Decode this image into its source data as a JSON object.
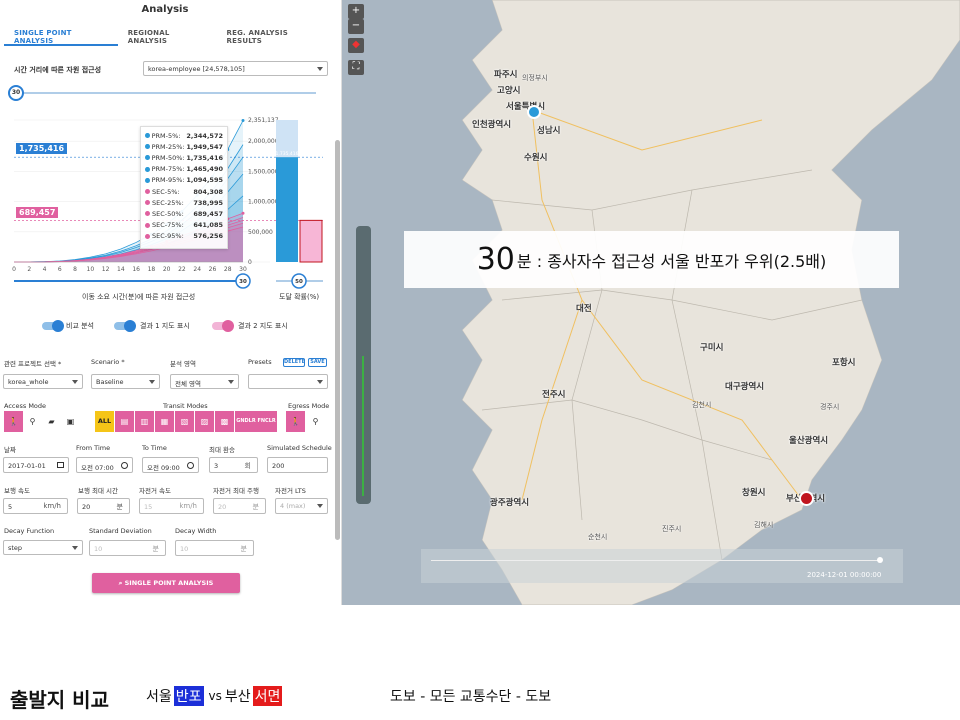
{
  "panel": {
    "title": "Analysis",
    "tabs": [
      "SINGLE POINT ANALYSIS",
      "REGIONAL ANALYSIS",
      "REG. ANALYSIS RESULTS"
    ],
    "accessibility_label": "시간 거리에 따른 자원 접근성",
    "dataset_select": "korea-employee [24,578,105]",
    "time_slider_value": "30"
  },
  "chart_data": {
    "type": "area",
    "x": [
      0,
      2,
      4,
      6,
      8,
      10,
      12,
      14,
      16,
      18,
      20,
      22,
      24,
      26,
      28,
      30
    ],
    "xlabel": "이동 소요 시간(분)에 따른 자원 접근성",
    "ylim": [
      0,
      2351137
    ],
    "yticks": [
      "2,351,137",
      "2,000,000",
      "1,500,000",
      "1,000,000",
      "500,000",
      "0"
    ],
    "primary_marker": "1,735,416",
    "secondary_marker": "689,457",
    "tooltip": [
      {
        "name": "PRM-5%:",
        "value": "2,344,572",
        "color": "#2a9ad8"
      },
      {
        "name": "PRM-25%:",
        "value": "1,949,547",
        "color": "#2a9ad8"
      },
      {
        "name": "PRM-50%:",
        "value": "1,735,416",
        "color": "#2a9ad8"
      },
      {
        "name": "PRM-75%:",
        "value": "1,465,490",
        "color": "#2a9ad8"
      },
      {
        "name": "PRM-95%:",
        "value": "1,094,595",
        "color": "#2a9ad8"
      },
      {
        "name": "SEC-5%:",
        "value": "804,308",
        "color": "#e0609f"
      },
      {
        "name": "SEC-25%:",
        "value": "738,995",
        "color": "#e0609f"
      },
      {
        "name": "SEC-50%:",
        "value": "689,457",
        "color": "#e0609f"
      },
      {
        "name": "SEC-75%:",
        "value": "641,085",
        "color": "#e0609f"
      },
      {
        "name": "SEC-95%:",
        "value": "576,256",
        "color": "#e0609f"
      }
    ],
    "primary_series": [
      0,
      800,
      4000,
      12000,
      30000,
      60000,
      100000,
      160000,
      240000,
      340000,
      460000,
      620000,
      820000,
      1050000,
      1380000,
      1735416
    ],
    "secondary_series": [
      0,
      500,
      2500,
      8000,
      20000,
      40000,
      70000,
      110000,
      160000,
      220000,
      290000,
      370000,
      450000,
      530000,
      610000,
      689457
    ],
    "bar_primary": "1,735,416",
    "bar_secondary": "689,457",
    "bar_xlabel": "도달 확률(%)",
    "bar_slider_value": "50"
  },
  "toggles": {
    "compare": "비교 분석",
    "map1": "결과 1 지도 표시",
    "map2": "결과 2 지도 표시"
  },
  "form": {
    "project_label": "관련 프로젝트 선택 *",
    "project_value": "korea_whole",
    "scenario_label": "Scenario *",
    "scenario_value": "Baseline",
    "area_label": "분석 영역",
    "area_value": "전체 영역",
    "presets_label": "Presets",
    "delete": "DELETE",
    "save": "SAVE",
    "access_mode": "Access Mode",
    "transit_modes": "Transit Modes",
    "egress_mode": "Egress Mode",
    "transit_all": "ALL",
    "transit_extra": "GNDLR FNCLR",
    "date_label": "날짜",
    "date_value": "2017-01-01",
    "from_label": "From Time",
    "from_value": "오전 07:00",
    "to_label": "To Time",
    "to_value": "오전 09:00",
    "transfer_label": "최대 환승",
    "transfer_value": "3",
    "transfer_unit": "회",
    "schedule_label": "Simulated Schedule",
    "schedule_value": "200",
    "walk_speed_label": "보행 속도",
    "walk_speed_value": "5",
    "walk_speed_unit": "km/h",
    "walk_max_label": "보행 최대 시간",
    "walk_max_value": "20",
    "walk_max_unit": "분",
    "bike_speed_label": "자전거 속도",
    "bike_speed_value": "15",
    "bike_speed_unit": "km/h",
    "bike_max_label": "자전거 최대 주행",
    "bike_max_value": "20",
    "bike_max_unit": "분",
    "bike_lts_label": "자전거 LTS",
    "bike_lts_value": "4 (max)",
    "decay_label": "Decay Function",
    "decay_value": "step",
    "stddev_label": "Standard Deviation",
    "stddev_value": "10",
    "stddev_unit": "분",
    "decay_width_label": "Decay Width",
    "decay_width_value": "10",
    "decay_width_unit": "분",
    "run": "SINGLE POINT ANALYSIS"
  },
  "map": {
    "banner_number": "30",
    "banner_text": "분 : 종사자수 접근성 서울 반포가 우위(2.5배)",
    "timestamp": "2024-12-01 00:00:00",
    "cities": [
      {
        "name": "파주시",
        "cls": "bold"
      },
      {
        "name": "의정부시",
        "cls": "small"
      },
      {
        "name": "고양시",
        "cls": "bold"
      },
      {
        "name": "서울특별시",
        "cls": "bold"
      },
      {
        "name": "인천광역시",
        "cls": "bold"
      },
      {
        "name": "성남시",
        "cls": "bold"
      },
      {
        "name": "수원시",
        "cls": "bold"
      },
      {
        "name": "대전",
        "cls": "bold"
      },
      {
        "name": "구미시",
        "cls": "bold"
      },
      {
        "name": "대구광역시",
        "cls": "bold"
      },
      {
        "name": "포항시",
        "cls": "bold"
      },
      {
        "name": "전주시",
        "cls": "bold"
      },
      {
        "name": "울산광역시",
        "cls": "bold"
      },
      {
        "name": "창원시",
        "cls": "bold"
      },
      {
        "name": "부산광역시",
        "cls": "bold"
      },
      {
        "name": "광주광역시",
        "cls": "bold"
      },
      {
        "name": "김천시",
        "cls": "small"
      },
      {
        "name": "경주시",
        "cls": "small"
      },
      {
        "name": "김해시",
        "cls": "small"
      },
      {
        "name": "순천시",
        "cls": "small"
      },
      {
        "name": "진주시",
        "cls": "small"
      }
    ]
  },
  "footer": {
    "title": "출발지 비교",
    "origin1_city": "서울",
    "origin1_hl": "반포",
    "vs": "vs",
    "origin2_city": "부산",
    "origin2_hl": "서면",
    "mode": "도보 - 모든 교통수단 - 도보"
  }
}
